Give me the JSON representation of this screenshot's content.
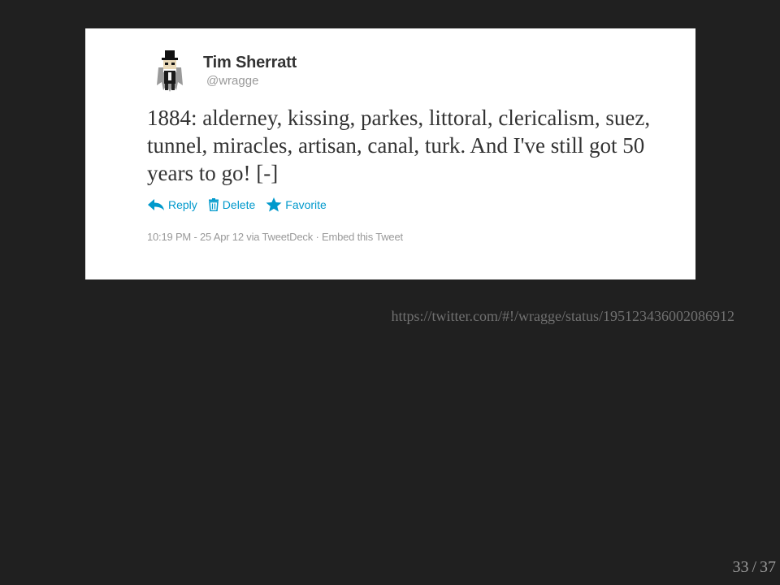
{
  "tweet": {
    "author_name": "Tim Sherratt",
    "author_handle": "@wragge",
    "text": "1884: alderney, kissing, parkes, littoral, clericalism, suez, tunnel, miracles, artisan, canal, turk. And I've still got 50 years to go! [-]",
    "actions": {
      "reply": "Reply",
      "delete": "Delete",
      "favorite": "Favorite"
    },
    "meta": {
      "timestamp": "10:19 PM - 25 Apr 12",
      "via_prefix": "via",
      "client": "TweetDeck",
      "separator": "·",
      "embed": "Embed this Tweet"
    },
    "colors": {
      "action_blue": "#0099cc",
      "text": "#333333",
      "muted": "#999999"
    }
  },
  "source_url": "https://twitter.com/#!/wragge/status/195123436002086912",
  "slide": {
    "current": "33",
    "separator": "/",
    "total": "37"
  },
  "icons": {
    "avatar": "avatar-icon",
    "reply": "reply-icon",
    "delete": "trash-icon",
    "favorite": "star-icon"
  }
}
